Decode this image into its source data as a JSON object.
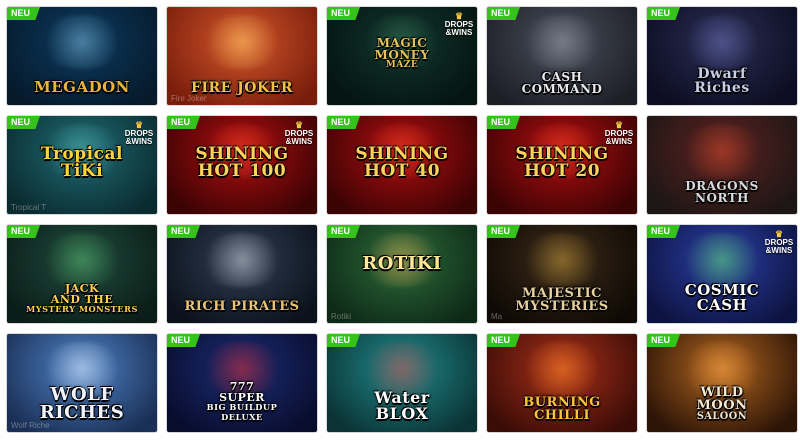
{
  "badges": {
    "new": "NEU",
    "drops_wins": [
      "DROPS",
      "&WINS"
    ]
  },
  "games": [
    {
      "title": [
        "MEGADON"
      ],
      "neu": true,
      "drops": false,
      "caption": "",
      "bg": [
        "#0b3a5e",
        "#061a2c"
      ],
      "glow": "#7fb7d9",
      "color": "#e8b53a",
      "size": 15,
      "pos": "low"
    },
    {
      "title": [
        "FIRE JOKER"
      ],
      "neu": false,
      "drops": false,
      "caption": "Fire Joker",
      "bg": [
        "#d2552a",
        "#7a1e0c"
      ],
      "glow": "#ffcf6a",
      "color": "#f0c24a",
      "size": 14,
      "pos": "low"
    },
    {
      "title": [
        "MAGIC",
        "MONEY",
        "MAZE"
      ],
      "neu": true,
      "drops": true,
      "caption": "",
      "bg": [
        "#12352d",
        "#041410"
      ],
      "glow": "#3b7a5c",
      "color": "#e4c35a",
      "size": 12,
      "pos": "mid"
    },
    {
      "title": [
        "CASH",
        "COMMAND"
      ],
      "neu": true,
      "drops": false,
      "caption": "",
      "bg": [
        "#4a4e5a",
        "#1c1f26"
      ],
      "glow": "#9aa1ad",
      "color": "#e9e9ee",
      "size": 12,
      "pos": "low"
    },
    {
      "title": [
        "Dwarf",
        "Riches"
      ],
      "neu": true,
      "drops": false,
      "caption": "",
      "bg": [
        "#2a2d52",
        "#0c0d22"
      ],
      "glow": "#6b71b8",
      "color": "#c8cde8",
      "size": 14,
      "pos": "low"
    },
    {
      "title": [
        "Tropical",
        "TiKi"
      ],
      "neu": true,
      "drops": true,
      "caption": "Tropical T",
      "bg": [
        "#1f6b73",
        "#0a2b30"
      ],
      "glow": "#55b6b0",
      "color": "#ffd43a",
      "size": 17,
      "pos": "mid"
    },
    {
      "title": [
        "SHINING",
        "HOT 100"
      ],
      "neu": true,
      "drops": true,
      "caption": "",
      "bg": [
        "#b10e10",
        "#3a0304"
      ],
      "glow": "#ff4a2a",
      "color": "#ffd35a",
      "size": 17,
      "pos": "mid"
    },
    {
      "title": [
        "SHINING",
        "HOT 40"
      ],
      "neu": true,
      "drops": false,
      "caption": "",
      "bg": [
        "#b10e10",
        "#3a0304"
      ],
      "glow": "#ff4a2a",
      "color": "#ffd35a",
      "size": 17,
      "pos": "mid"
    },
    {
      "title": [
        "SHINING",
        "HOT 20"
      ],
      "neu": true,
      "drops": true,
      "caption": "",
      "bg": [
        "#b10e10",
        "#3a0304"
      ],
      "glow": "#ff4a2a",
      "color": "#ffd35a",
      "size": 17,
      "pos": "mid"
    },
    {
      "title": [
        "DRAGONS",
        "NORTH"
      ],
      "neu": false,
      "drops": false,
      "caption": "",
      "bg": [
        "#5d2220",
        "#1c1615"
      ],
      "glow": "#d04a2c",
      "color": "#d8dade",
      "size": 12,
      "pos": "low"
    },
    {
      "title": [
        "JACK",
        "AND THE",
        "MYSTERY MONSTERS"
      ],
      "neu": true,
      "drops": false,
      "caption": "",
      "bg": [
        "#1f4b3e",
        "#0b1d18"
      ],
      "glow": "#5ab86c",
      "color": "#ffd34a",
      "size": 11,
      "pos": "low"
    },
    {
      "title": [
        "RICH PIRATES"
      ],
      "neu": true,
      "drops": false,
      "caption": "",
      "bg": [
        "#2e3d52",
        "#0c121c"
      ],
      "glow": "#cfd6dd",
      "color": "#e9c377",
      "size": 13,
      "pos": "low"
    },
    {
      "title": [
        "ROTIKI"
      ],
      "neu": true,
      "drops": false,
      "caption": "Rotiki",
      "bg": [
        "#2c6b3a",
        "#0e2a17"
      ],
      "glow": "#e7b15a",
      "color": "#ffe79a",
      "size": 18,
      "pos": "mid"
    },
    {
      "title": [
        "MAJESTIC",
        "MYSTERIES"
      ],
      "neu": true,
      "drops": false,
      "caption": "Ma",
      "bg": [
        "#3a2a18",
        "#0f0a05"
      ],
      "glow": "#c79a3e",
      "color": "#e6d0a0",
      "size": 13,
      "pos": "low"
    },
    {
      "title": [
        "COSMIC",
        "CASH"
      ],
      "neu": true,
      "drops": true,
      "caption": "",
      "bg": [
        "#2b3fa6",
        "#0d1340"
      ],
      "glow": "#5fe06a",
      "color": "#ffffff",
      "size": 15,
      "pos": "low"
    },
    {
      "title": [
        "WOLF",
        "RICHES"
      ],
      "neu": false,
      "drops": false,
      "caption": "Wolf Riche",
      "bg": [
        "#4f84c8",
        "#1a2f55"
      ],
      "glow": "#dfeaf7",
      "color": "#f0f4ff",
      "size": 18,
      "pos": "low"
    },
    {
      "title": [
        "777",
        "SUPER",
        "BIG BUILDUP",
        "DELUXE"
      ],
      "neu": true,
      "drops": false,
      "caption": "",
      "bg": [
        "#1c2c75",
        "#080d2d"
      ],
      "glow": "#e02a2a",
      "color": "#ffffff",
      "size": 11,
      "pos": "low"
    },
    {
      "title": [
        "Water",
        "BLOX"
      ],
      "neu": true,
      "drops": false,
      "caption": "",
      "bg": [
        "#1f8a8c",
        "#0b3335"
      ],
      "glow": "#d24a4a",
      "color": "#ffffff",
      "size": 16,
      "pos": "low"
    },
    {
      "title": [
        "BURNING",
        "CHILLI"
      ],
      "neu": true,
      "drops": false,
      "caption": "",
      "bg": [
        "#a8301a",
        "#3a0c06"
      ],
      "glow": "#ff8a2a",
      "color": "#ffc43a",
      "size": 13,
      "pos": "low"
    },
    {
      "title": [
        "WILD",
        "MOON",
        "SALOON"
      ],
      "neu": true,
      "drops": false,
      "caption": "",
      "bg": [
        "#b0651e",
        "#2c1407"
      ],
      "glow": "#f5a34a",
      "color": "#f4e9d0",
      "size": 13,
      "pos": "low"
    }
  ]
}
